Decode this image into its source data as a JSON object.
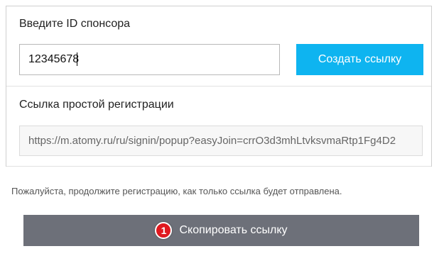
{
  "sponsor": {
    "label": "Введите ID спонсора",
    "input_value": "12345678",
    "create_button_label": "Создать ссылку"
  },
  "registration_link": {
    "label": "Ссылка простой регистрации",
    "value": "https://m.atomy.ru/ru/signin/popup?easyJoin=crrO3d3mhLtvksvmaRtp1Fg4D2"
  },
  "notice_text": "Пожалуйста, продолжите регистрацию, как только ссылка будет отправлена.",
  "copy": {
    "badge": "1",
    "button_label": "Скопировать ссылку"
  },
  "colors": {
    "accent": "#0eb4f0",
    "copy_button": "#6d7079",
    "badge": "#e0191f"
  }
}
